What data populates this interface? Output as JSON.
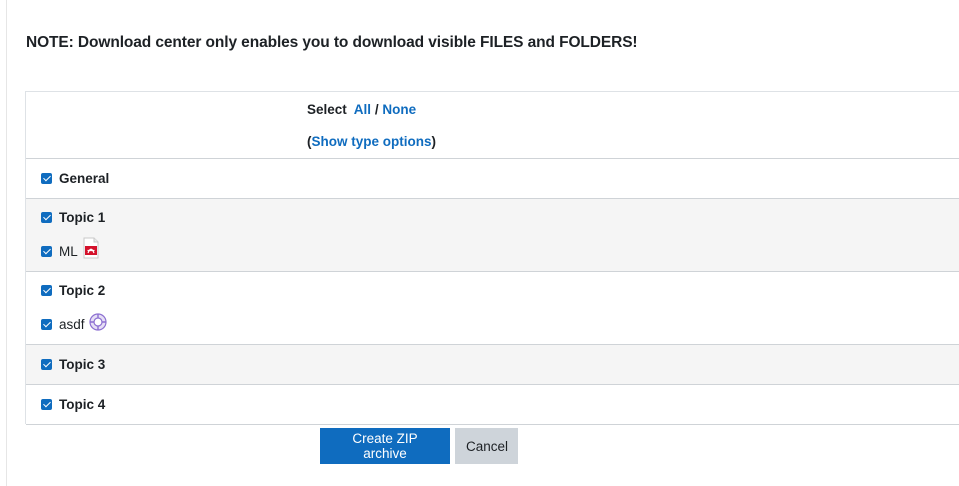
{
  "note": "NOTE: Download center only enables you to download visible FILES and FOLDERS!",
  "select": {
    "label": "Select",
    "all": "All",
    "separator": "/",
    "none": "None",
    "open_paren": "(",
    "type_options": "Show type options",
    "close_paren": ")"
  },
  "sections": [
    {
      "label": "General",
      "checked": true,
      "items": []
    },
    {
      "label": "Topic 1",
      "checked": true,
      "items": [
        {
          "label": "ML",
          "checked": true,
          "icon": "pdf-icon"
        }
      ]
    },
    {
      "label": "Topic 2",
      "checked": true,
      "items": [
        {
          "label": "asdf",
          "checked": true,
          "icon": "h5p-activity-icon"
        }
      ]
    },
    {
      "label": "Topic 3",
      "checked": true,
      "items": []
    },
    {
      "label": "Topic 4",
      "checked": true,
      "items": []
    }
  ],
  "buttons": {
    "create": "Create ZIP archive",
    "cancel": "Cancel"
  },
  "colors": {
    "link": "#0f6cbf",
    "primary": "#0f6cbf",
    "secondary": "#ced4da",
    "shaded": "#f5f5f5"
  }
}
